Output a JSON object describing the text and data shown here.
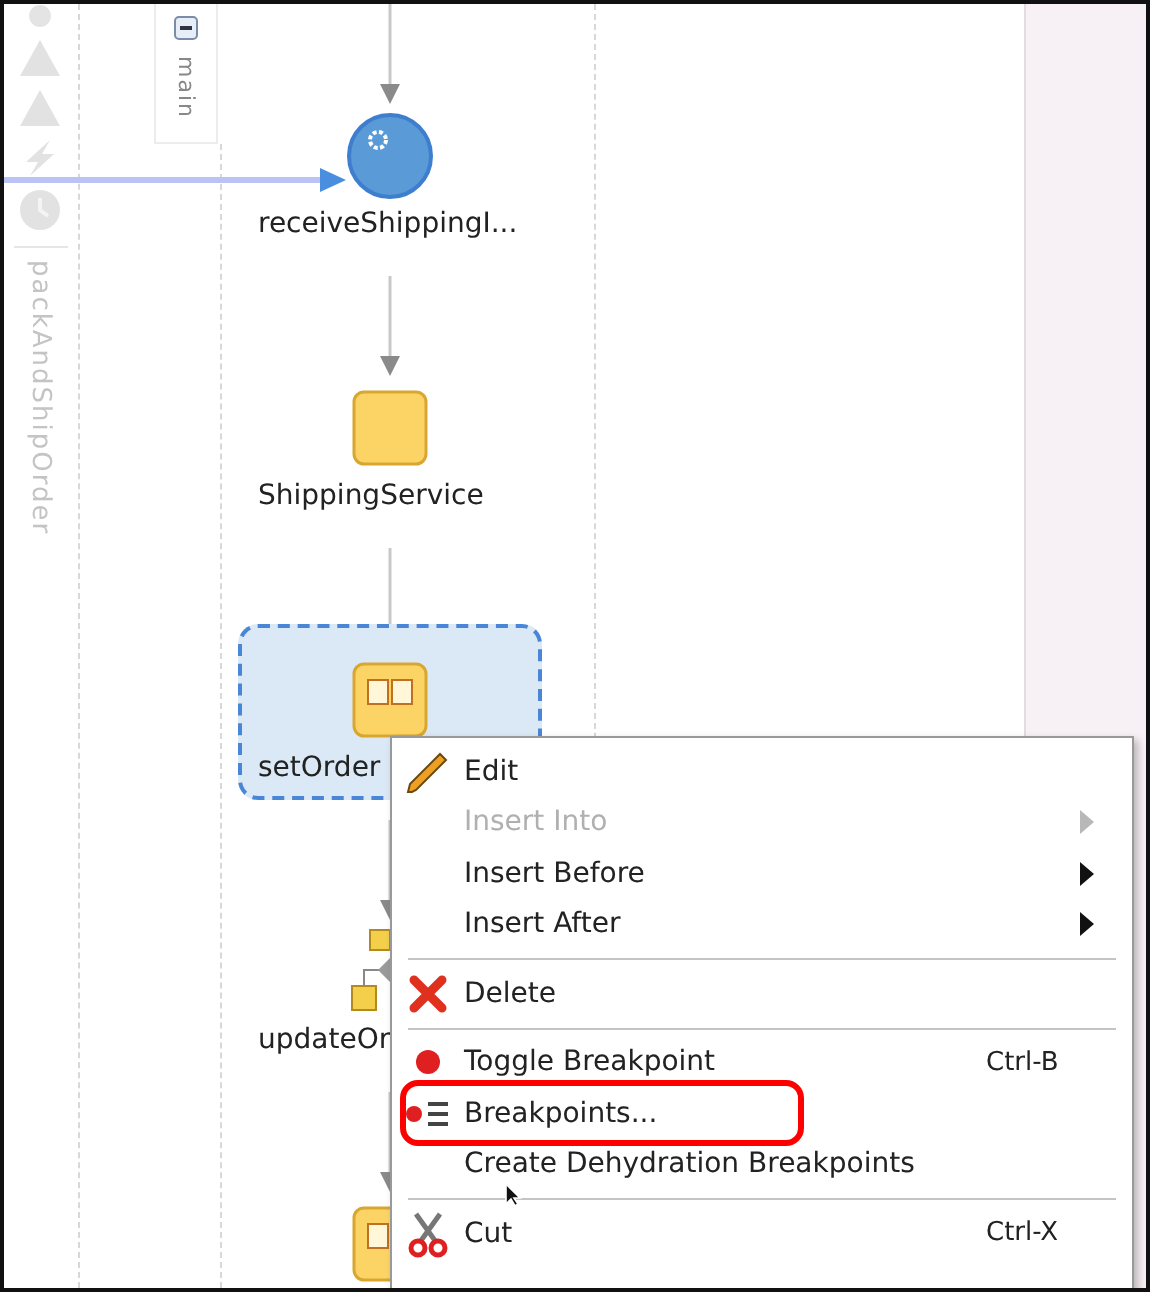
{
  "palette": {
    "label": "packAndShipOrder"
  },
  "lane": {
    "label": "main",
    "expanded": true
  },
  "nodes": [
    {
      "kind": "receive",
      "label": "receiveShippingI...",
      "selected": false
    },
    {
      "kind": "service",
      "label": "ShippingService",
      "selected": false
    },
    {
      "kind": "assign",
      "label": "setOrder",
      "selected": true
    },
    {
      "kind": "gateway",
      "label": "updateOr",
      "selected": false
    },
    {
      "kind": "assign",
      "selected": false
    }
  ],
  "context_menu": [
    {
      "kind": "edit",
      "label": "Edit",
      "disabled": false,
      "submenu": false
    },
    {
      "kind": "item",
      "label": "Insert Into",
      "disabled": true,
      "submenu": true
    },
    {
      "kind": "item",
      "label": "Insert Before",
      "disabled": false,
      "submenu": true
    },
    {
      "kind": "item",
      "label": "Insert After",
      "disabled": false,
      "submenu": true
    },
    {
      "kind": "separator"
    },
    {
      "kind": "delete",
      "label": "Delete",
      "disabled": false,
      "submenu": false
    },
    {
      "kind": "separator"
    },
    {
      "kind": "toggle",
      "label": "Toggle Breakpoint",
      "shortcut": "Ctrl-B",
      "disabled": false,
      "submenu": false
    },
    {
      "kind": "breakpoints",
      "label": "Breakpoints...",
      "disabled": false,
      "submenu": false
    },
    {
      "kind": "item",
      "label": "Create Dehydration Breakpoints",
      "disabled": false,
      "submenu": false
    },
    {
      "kind": "separator"
    },
    {
      "kind": "cut",
      "label": "Cut",
      "shortcut": "Ctrl-X",
      "disabled": false,
      "submenu": false
    }
  ]
}
